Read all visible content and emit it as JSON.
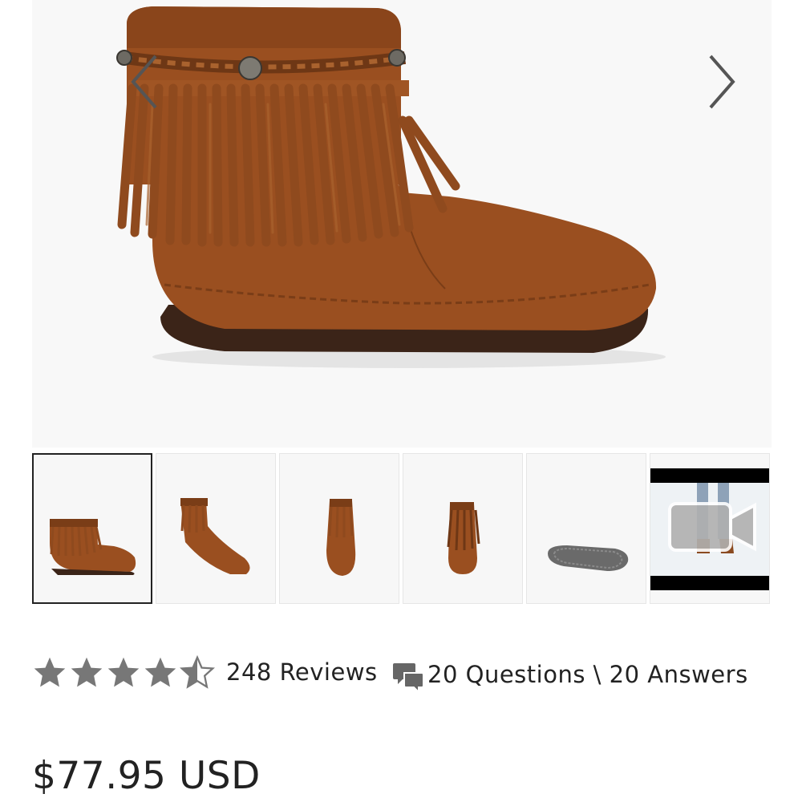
{
  "product": {
    "main_image_alt": "brown suede fringe ankle boot",
    "thumbnails": [
      {
        "name": "side view",
        "active": true
      },
      {
        "name": "angled view",
        "active": false
      },
      {
        "name": "front view",
        "active": false
      },
      {
        "name": "back view",
        "active": false
      },
      {
        "name": "sole view",
        "active": false
      },
      {
        "name": "video",
        "active": false,
        "icon": "video-camera-icon"
      }
    ],
    "rating": {
      "stars": 4.5,
      "reviews_label": "248 Reviews",
      "qa_label": "20 Questions \\ 20 Answers"
    },
    "price": "$77.95 USD"
  },
  "colors": {
    "suede": "#9a4f20",
    "suede_dark": "#7a3d17",
    "sole": "#3b2418",
    "star": "#777777",
    "text": "#222222"
  },
  "icons": {
    "prev": "chevron-left-icon",
    "next": "chevron-right-icon",
    "star": "star-icon",
    "questions": "speech-bubbles-icon"
  }
}
